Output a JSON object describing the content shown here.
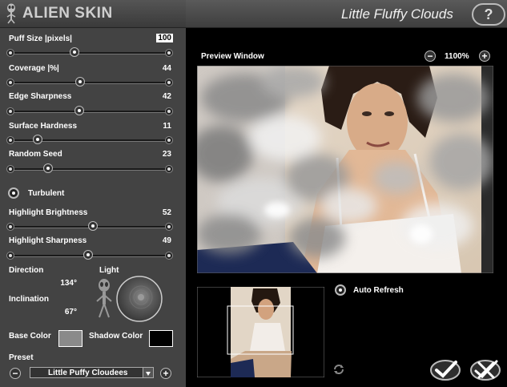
{
  "header": {
    "brand": "ALIEN SKIN",
    "filter_title": "Little Fluffy Clouds",
    "help_label": "?"
  },
  "controls": {
    "puff_size": {
      "label": "Puff Size |pixels|",
      "value": "100",
      "fraction": 0.4
    },
    "coverage": {
      "label": "Coverage |%|",
      "value": "44",
      "fraction": 0.44
    },
    "edge_sharpness": {
      "label": "Edge Sharpness",
      "value": "42",
      "fraction": 0.43
    },
    "surface_hardness": {
      "label": "Surface Hardness",
      "value": "11",
      "fraction": 0.16
    },
    "random_seed": {
      "label": "Random Seed",
      "value": "23",
      "fraction": 0.23
    },
    "turbulent": {
      "label": "Turbulent"
    },
    "highlight_brightness": {
      "label": "Highlight Brightness",
      "value": "52",
      "fraction": 0.52
    },
    "highlight_sharpness": {
      "label": "Highlight Sharpness",
      "value": "49",
      "fraction": 0.49
    },
    "direction": {
      "label": "Direction",
      "value": "134°"
    },
    "inclination": {
      "label": "Inclination",
      "value": "67°"
    },
    "light": {
      "label": "Light"
    },
    "base_color": {
      "label": "Base Color",
      "color": "#8a8a8a"
    },
    "shadow_color": {
      "label": "Shadow Color",
      "color": "#000000"
    },
    "preset": {
      "label": "Preset",
      "selected": "Little Puffy Cloudees",
      "minus": "−",
      "plus": "+"
    }
  },
  "preview": {
    "title": "Preview Window",
    "zoom": "1100%",
    "zoom_out": "−",
    "zoom_in": "+",
    "auto_refresh_label": "Auto Refresh"
  },
  "colors": {
    "panel_bg": "#434343",
    "accent_white": "#ffffff"
  }
}
